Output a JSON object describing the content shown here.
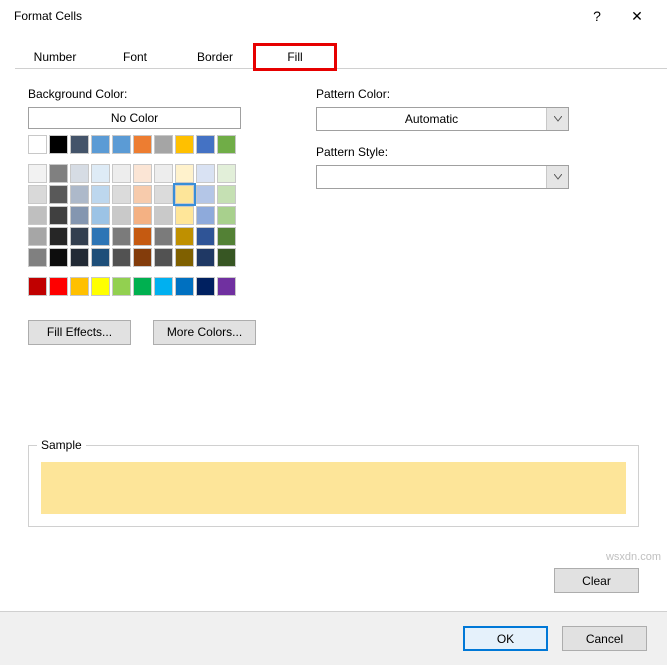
{
  "titlebar": {
    "title": "Format Cells",
    "help": "?",
    "close": "✕"
  },
  "tabs": {
    "number": "Number",
    "font": "Font",
    "border": "Border",
    "fill": "Fill"
  },
  "fill": {
    "bg_label": "Background Color:",
    "no_color": "No Color",
    "fill_effects": "Fill Effects...",
    "more_colors": "More Colors...",
    "pattern_color_label": "Pattern Color:",
    "pattern_color_value": "Automatic",
    "pattern_style_label": "Pattern Style:",
    "pattern_style_value": ""
  },
  "sample": {
    "label": "Sample",
    "color": "#fde599"
  },
  "buttons": {
    "clear": "Clear",
    "ok": "OK",
    "cancel": "Cancel"
  },
  "watermark": "wsxdn.com",
  "palette": {
    "row0": [
      "#ffffff",
      "#000000",
      "#44546a",
      "#5b9bd5",
      "#5b9bd5",
      "#ed7d31",
      "#a5a5a5",
      "#ffc000",
      "#4472c4",
      "#70ad47"
    ],
    "theme": [
      [
        "#f2f2f2",
        "#808080",
        "#d6dce4",
        "#deebf6",
        "#ededed",
        "#fbe5d5",
        "#ededed",
        "#fff2cc",
        "#d9e2f3",
        "#e2efd9"
      ],
      [
        "#d9d9d9",
        "#595959",
        "#adb9ca",
        "#bdd7ee",
        "#dbdbdb",
        "#f7cbac",
        "#dbdbdb",
        "#fde599",
        "#b4c6e7",
        "#c5e0b3"
      ],
      [
        "#bfbfbf",
        "#404040",
        "#8496b0",
        "#9cc3e5",
        "#c9c9c9",
        "#f4b183",
        "#c9c9c9",
        "#ffe699",
        "#8eaadb",
        "#a8d08d"
      ],
      [
        "#a6a6a6",
        "#262626",
        "#333f4f",
        "#2e75b5",
        "#7b7b7b",
        "#c55a11",
        "#7b7b7b",
        "#bf9000",
        "#2f5496",
        "#538135"
      ],
      [
        "#808080",
        "#0d0d0d",
        "#222a35",
        "#1e4e79",
        "#525252",
        "#833c0b",
        "#525252",
        "#7f6000",
        "#1f3864",
        "#375623"
      ]
    ],
    "standard": [
      "#c00000",
      "#ff0000",
      "#ffc000",
      "#ffff00",
      "#92d050",
      "#00b050",
      "#00b0f0",
      "#0070c0",
      "#002060",
      "#7030a0"
    ]
  },
  "selected_swatch": "#fde599"
}
